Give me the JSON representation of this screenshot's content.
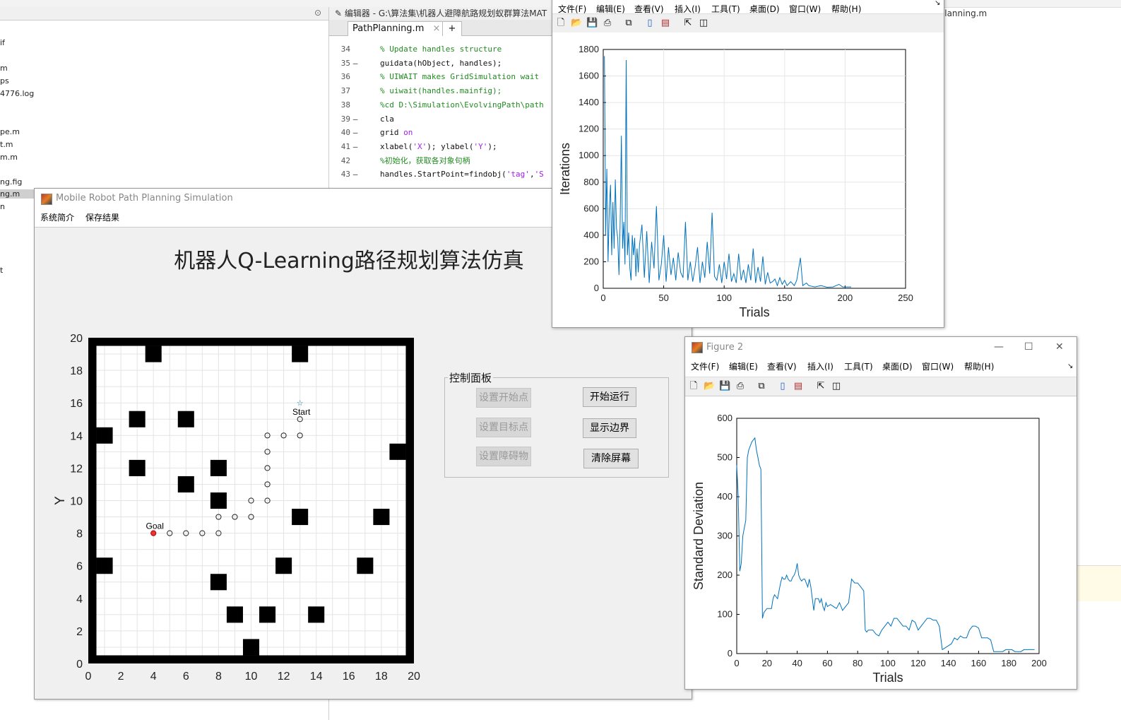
{
  "ide": {
    "file_browser_items": [
      "if",
      "m",
      "ps",
      "4776.log",
      "pe.m",
      "t.m",
      "m.m",
      "ng.fig",
      "ng.m",
      "n",
      "t"
    ],
    "editor_title": "编辑器 - G:\\算法集\\机器人避障航路规划蚁群算法MAT",
    "tab_label": "PathPlanning.m",
    "tab_close": "×",
    "tab_add": "+",
    "code_lines": [
      {
        "n": "34",
        "d": "",
        "html": "<span class='cmt'>% Update handles structure</span>"
      },
      {
        "n": "35",
        "d": "–",
        "html": "guidata(hObject, handles);"
      },
      {
        "n": "36",
        "d": "",
        "html": "<span class='cmt'>% UIWAIT makes GridSimulation wait</span>"
      },
      {
        "n": "37",
        "d": "",
        "html": "<span class='cmt'>% uiwait(handles.mainfig);</span>"
      },
      {
        "n": "38",
        "d": "",
        "html": "<span class='cmt'>%cd D:\\Simulation\\EvolvingPath\\path</span>"
      },
      {
        "n": "39",
        "d": "–",
        "html": "cla"
      },
      {
        "n": "40",
        "d": "–",
        "html": "grid <span class='kw'>on</span>"
      },
      {
        "n": "41",
        "d": "–",
        "html": "xlabel(<span class='str'>'X'</span>); ylabel(<span class='str'>'Y'</span>);"
      },
      {
        "n": "42",
        "d": "",
        "html": "<span class='cmt'>%初始化，获取各对象句柄</span>"
      },
      {
        "n": "43",
        "d": "–",
        "html": "handles.StartPoint=findobj(<span class='str'>'tag'</span>,<span class='str'>'S</span>"
      }
    ],
    "right_title": "Planning.m"
  },
  "gui": {
    "title": "Mobile Robot Path Planning Simulation",
    "menu": [
      "系统简介",
      "保存结果"
    ],
    "heading": "机器人Q-Learning路径规划算法仿真",
    "control_panel": {
      "legend": "控制面板",
      "buttons": [
        {
          "label": "设置开始点",
          "enabled": false
        },
        {
          "label": "开始运行",
          "enabled": true
        },
        {
          "label": "设置目标点",
          "enabled": false
        },
        {
          "label": "显示边界",
          "enabled": true
        },
        {
          "label": "设置障碍物",
          "enabled": false
        },
        {
          "label": "清除屏幕",
          "enabled": true
        }
      ]
    }
  },
  "fig1": {
    "menu": [
      "文件(F)",
      "编辑(E)",
      "查看(V)",
      "插入(I)",
      "工具(T)",
      "桌面(D)",
      "窗口(W)",
      "帮助(H)"
    ]
  },
  "fig2": {
    "title": "Figure 2",
    "menu": [
      "文件(F)",
      "编辑(E)",
      "查看(V)",
      "插入(I)",
      "工具(T)",
      "桌面(D)",
      "窗口(W)",
      "帮助(H)"
    ]
  },
  "chart_data": [
    {
      "type": "scatter",
      "xlabel": "X",
      "ylabel": "Y",
      "xlim": [
        0,
        20
      ],
      "ylim": [
        0,
        20
      ],
      "xticks": [
        0,
        2,
        4,
        6,
        8,
        10,
        12,
        14,
        16,
        18,
        20
      ],
      "yticks": [
        0,
        2,
        4,
        6,
        8,
        10,
        12,
        14,
        16,
        18,
        20
      ],
      "grid": true,
      "obstacles": [
        [
          4,
          19
        ],
        [
          13,
          19
        ],
        [
          1,
          14
        ],
        [
          3,
          15
        ],
        [
          6,
          15
        ],
        [
          3,
          12
        ],
        [
          8,
          12
        ],
        [
          6,
          11
        ],
        [
          8,
          10
        ],
        [
          19,
          13
        ],
        [
          13,
          9
        ],
        [
          18,
          9
        ],
        [
          1,
          6
        ],
        [
          12,
          6
        ],
        [
          17,
          6
        ],
        [
          8,
          5
        ],
        [
          9,
          3
        ],
        [
          11,
          3
        ],
        [
          14,
          3
        ],
        [
          10,
          1
        ]
      ],
      "path": [
        [
          13,
          15
        ],
        [
          13,
          14
        ],
        [
          12,
          14
        ],
        [
          11,
          14
        ],
        [
          11,
          13
        ],
        [
          11,
          12
        ],
        [
          11,
          11
        ],
        [
          11,
          10
        ],
        [
          10,
          10
        ],
        [
          10,
          9
        ],
        [
          9,
          9
        ],
        [
          8,
          9
        ],
        [
          8,
          8
        ],
        [
          7,
          8
        ],
        [
          6,
          8
        ],
        [
          5,
          8
        ]
      ],
      "start": {
        "x": 13,
        "y": 16,
        "label": "Start"
      },
      "goal": {
        "x": 4,
        "y": 8,
        "label": "Goal"
      },
      "border": true
    },
    {
      "type": "line",
      "xlabel": "Trials",
      "ylabel": "Iterations",
      "xlim": [
        0,
        250
      ],
      "ylim": [
        0,
        1800
      ],
      "xticks": [
        0,
        50,
        100,
        150,
        200,
        250
      ],
      "yticks": [
        0,
        200,
        400,
        600,
        800,
        1000,
        1200,
        1400,
        1600,
        1800
      ],
      "grid": true,
      "color": "#0072bd",
      "x": [
        1,
        2,
        3,
        4,
        5,
        6,
        7,
        8,
        9,
        10,
        11,
        12,
        13,
        14,
        15,
        16,
        17,
        18,
        19,
        20,
        21,
        22,
        23,
        24,
        25,
        26,
        27,
        28,
        29,
        30,
        32,
        34,
        36,
        38,
        40,
        42,
        44,
        46,
        48,
        50,
        52,
        54,
        56,
        58,
        60,
        62,
        64,
        66,
        68,
        70,
        72,
        74,
        76,
        78,
        80,
        82,
        84,
        86,
        88,
        90,
        92,
        94,
        96,
        98,
        100,
        102,
        104,
        106,
        108,
        110,
        112,
        114,
        116,
        118,
        120,
        122,
        124,
        126,
        128,
        130,
        132,
        134,
        136,
        138,
        140,
        142,
        144,
        146,
        148,
        150,
        152,
        155,
        158,
        160,
        163,
        165,
        168,
        170,
        175,
        180,
        185,
        190,
        195,
        198,
        200,
        205
      ],
      "y": [
        1750,
        400,
        900,
        200,
        600,
        780,
        250,
        650,
        300,
        820,
        450,
        380,
        100,
        510,
        1150,
        300,
        500,
        180,
        1720,
        250,
        420,
        150,
        60,
        400,
        250,
        380,
        90,
        300,
        120,
        330,
        480,
        80,
        430,
        40,
        350,
        150,
        620,
        60,
        180,
        400,
        50,
        310,
        100,
        230,
        60,
        270,
        120,
        80,
        500,
        60,
        200,
        50,
        160,
        310,
        40,
        200,
        80,
        350,
        110,
        570,
        90,
        60,
        180,
        40,
        200,
        70,
        260,
        50,
        110,
        40,
        260,
        60,
        140,
        40,
        180,
        60,
        300,
        40,
        160,
        50,
        240,
        30,
        120,
        40,
        50,
        70,
        20,
        80,
        30,
        60,
        20,
        50,
        20,
        60,
        230,
        20,
        40,
        20,
        10,
        20,
        8,
        10,
        30,
        10,
        10,
        10
      ]
    },
    {
      "type": "line",
      "xlabel": "Trials",
      "ylabel": "Standard Deviation",
      "xlim": [
        0,
        200
      ],
      "ylim": [
        0,
        600
      ],
      "xticks": [
        0,
        20,
        40,
        60,
        80,
        100,
        120,
        140,
        160,
        180,
        200
      ],
      "yticks": [
        0,
        100,
        200,
        300,
        400,
        500,
        600
      ],
      "grid": false,
      "color": "#0072bd",
      "x": [
        0,
        1,
        2,
        3,
        4,
        5,
        6,
        7,
        8,
        9,
        10,
        11,
        12,
        13,
        14,
        15,
        16,
        17,
        18,
        19,
        20,
        21,
        23,
        24,
        25,
        26,
        27,
        28,
        29,
        30,
        31,
        32,
        33,
        34,
        35,
        36,
        37,
        38,
        39,
        40,
        41,
        42,
        43,
        44,
        45,
        46,
        47,
        48,
        49,
        50,
        51,
        52,
        53,
        54,
        55,
        56,
        57,
        58,
        59,
        60,
        62,
        64,
        66,
        68,
        70,
        72,
        74,
        76,
        78,
        80,
        82,
        84,
        85,
        86,
        87,
        88,
        90,
        92,
        94,
        96,
        98,
        100,
        102,
        104,
        106,
        108,
        110,
        112,
        114,
        116,
        118,
        120,
        122,
        124,
        126,
        128,
        130,
        132,
        134,
        136,
        138,
        140,
        142,
        144,
        146,
        148,
        150,
        152,
        154,
        156,
        158,
        160,
        162,
        164,
        166,
        168,
        170,
        172,
        174,
        176,
        178,
        180,
        182,
        184,
        186,
        188,
        190,
        192,
        194,
        196,
        197
      ],
      "y": [
        480,
        400,
        210,
        230,
        300,
        320,
        340,
        500,
        520,
        530,
        540,
        545,
        550,
        520,
        500,
        480,
        470,
        90,
        105,
        110,
        115,
        115,
        115,
        140,
        150,
        145,
        140,
        160,
        180,
        195,
        190,
        190,
        200,
        190,
        185,
        185,
        195,
        200,
        210,
        230,
        200,
        190,
        185,
        190,
        190,
        180,
        170,
        190,
        170,
        140,
        110,
        140,
        140,
        140,
        130,
        140,
        120,
        110,
        130,
        120,
        125,
        120,
        115,
        130,
        110,
        120,
        130,
        190,
        180,
        180,
        170,
        160,
        60,
        55,
        60,
        60,
        60,
        50,
        45,
        60,
        70,
        80,
        70,
        90,
        90,
        80,
        70,
        70,
        60,
        85,
        80,
        60,
        70,
        80,
        90,
        90,
        85,
        85,
        70,
        10,
        15,
        20,
        25,
        40,
        35,
        45,
        40,
        40,
        60,
        70,
        70,
        65,
        40,
        40,
        40,
        35,
        5,
        5,
        5,
        5,
        10,
        10,
        10,
        5,
        5,
        5,
        10,
        10,
        10,
        10,
        10
      ]
    }
  ]
}
